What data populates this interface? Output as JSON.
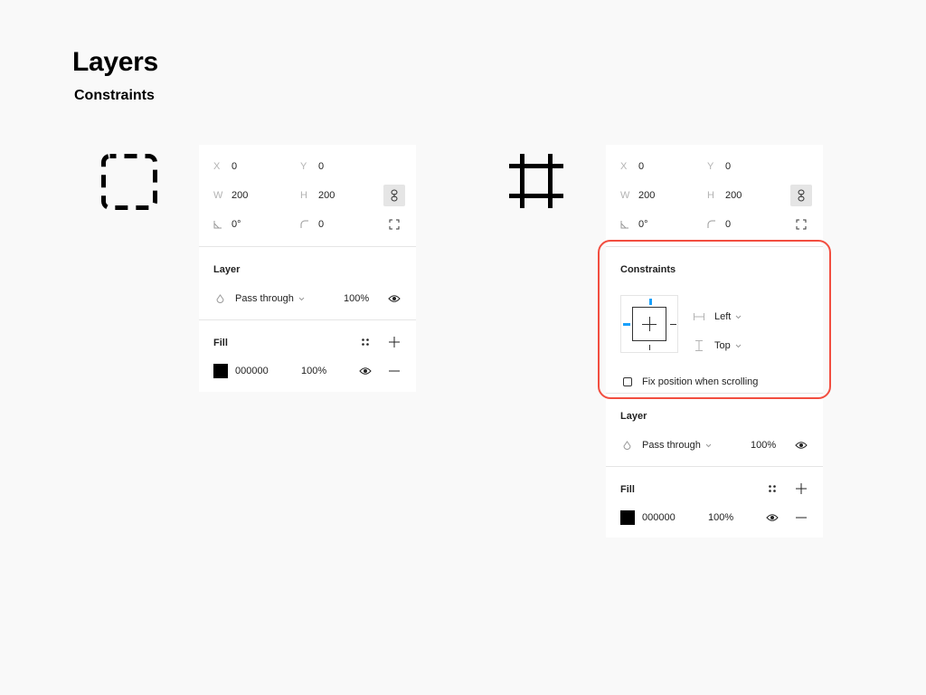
{
  "page": {
    "title": "Layers",
    "subtitle": "Constraints"
  },
  "left_panel": {
    "x": "0",
    "y": "0",
    "w": "200",
    "h": "200",
    "rotation": "0°",
    "radius": "0",
    "labels": {
      "x": "X",
      "y": "Y",
      "w": "W",
      "h": "H"
    },
    "layer": {
      "title": "Layer",
      "blend": "Pass through",
      "opacity": "100%"
    },
    "fill": {
      "title": "Fill",
      "hex": "000000",
      "opacity": "100%"
    }
  },
  "right_panel": {
    "x": "0",
    "y": "0",
    "w": "200",
    "h": "200",
    "rotation": "0°",
    "radius": "0",
    "labels": {
      "x": "X",
      "y": "Y",
      "w": "W",
      "h": "H"
    },
    "constraints": {
      "title": "Constraints",
      "horizontal": "Left",
      "vertical": "Top",
      "fix_label": "Fix position when scrolling"
    },
    "layer": {
      "title": "Layer",
      "blend": "Pass through",
      "opacity": "100%"
    },
    "fill": {
      "title": "Fill",
      "hex": "000000",
      "opacity": "100%"
    }
  },
  "colors": {
    "accent": "#18a0fb",
    "highlight": "#f24e40",
    "fill_swatch": "#000000"
  },
  "icons": [
    "dashed-frame-icon",
    "frame-hash-icon",
    "link-icon",
    "corner-angle-icon",
    "corner-radius-icon",
    "resize-corners-icon",
    "blend-drop-icon",
    "chevron-down-icon",
    "eye-icon",
    "styles-grid-icon",
    "plus-icon",
    "minus-icon",
    "horizontal-constraint-icon",
    "vertical-constraint-icon"
  ]
}
